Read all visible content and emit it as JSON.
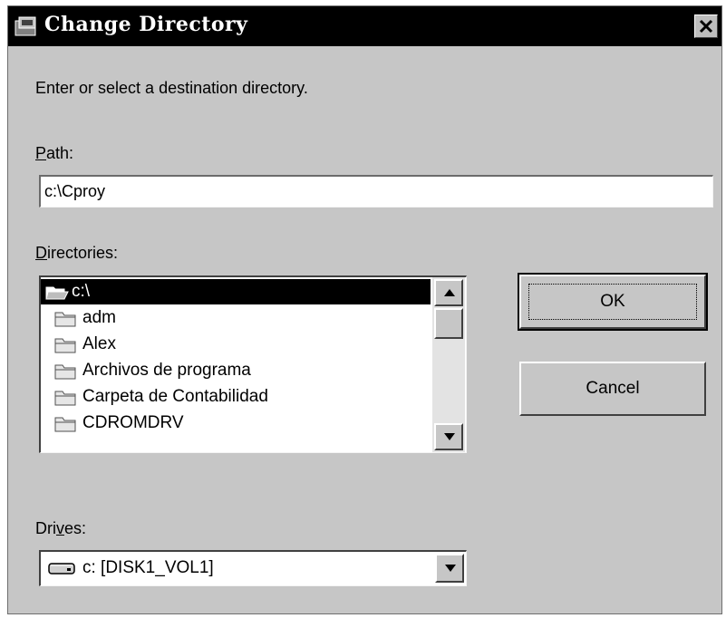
{
  "window": {
    "title": "Change Directory",
    "close_icon": "close-icon"
  },
  "instructions": "Enter or select a destination directory.",
  "path": {
    "label_access": "P",
    "label_rest": "ath:",
    "value": "c:\\Cproy"
  },
  "directories": {
    "label_access": "D",
    "label_rest": "irectories:",
    "items": [
      {
        "label": "c:\\",
        "icon": "open-folder-icon",
        "selected": true
      },
      {
        "label": "adm",
        "icon": "folder-icon"
      },
      {
        "label": "Alex",
        "icon": "folder-icon"
      },
      {
        "label": "Archivos de programa",
        "icon": "folder-icon"
      },
      {
        "label": "Carpeta de Contabilidad",
        "icon": "folder-icon"
      },
      {
        "label": "CDROMDRV",
        "icon": "folder-icon"
      }
    ]
  },
  "buttons": {
    "ok": "OK",
    "cancel": "Cancel"
  },
  "drives": {
    "label_pre": "Dri",
    "label_access": "v",
    "label_post": "es:",
    "value": "c: [DISK1_VOL1]",
    "icon": "hard-drive-icon"
  },
  "colors": {
    "dialog_bg": "#c6c6c6",
    "titlebar_bg": "#000000",
    "selection_bg": "#000000"
  }
}
